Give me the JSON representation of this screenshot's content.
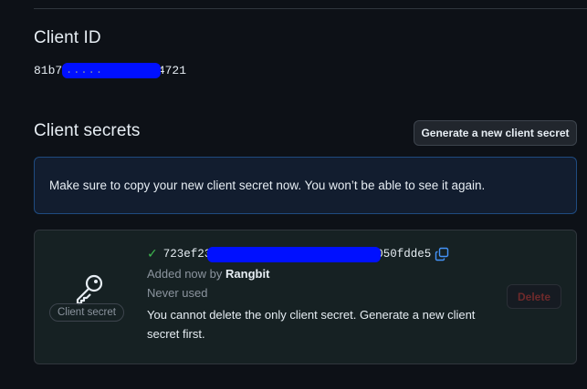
{
  "client_id": {
    "title": "Client ID",
    "value_prefix": "81b7b",
    "value_redacted_dots": ".....",
    "value_suffix": "14721"
  },
  "client_secrets": {
    "title": "Client secrets",
    "generate_button_label": "Generate a new client secret",
    "flash_message": "Make sure to copy your new client secret now. You won’t be able to see it again.",
    "secret": {
      "badge_label": "Client secret",
      "value_prefix": "723ef23",
      "value_suffix": "050fdde5",
      "added_text": "Added now by",
      "added_by": "Rangbit",
      "usage_text": "Never used",
      "delete_warning": "You cannot delete the only client secret. Generate a new client secret first.",
      "delete_button_label": "Delete"
    }
  },
  "icons": {
    "key": "key-icon",
    "check": "check-icon",
    "copy": "copy-icon"
  },
  "colors": {
    "background": "#0d1117",
    "accent_blue": "#4493f8",
    "success_green": "#3fb950",
    "danger_red": "#f85149"
  }
}
